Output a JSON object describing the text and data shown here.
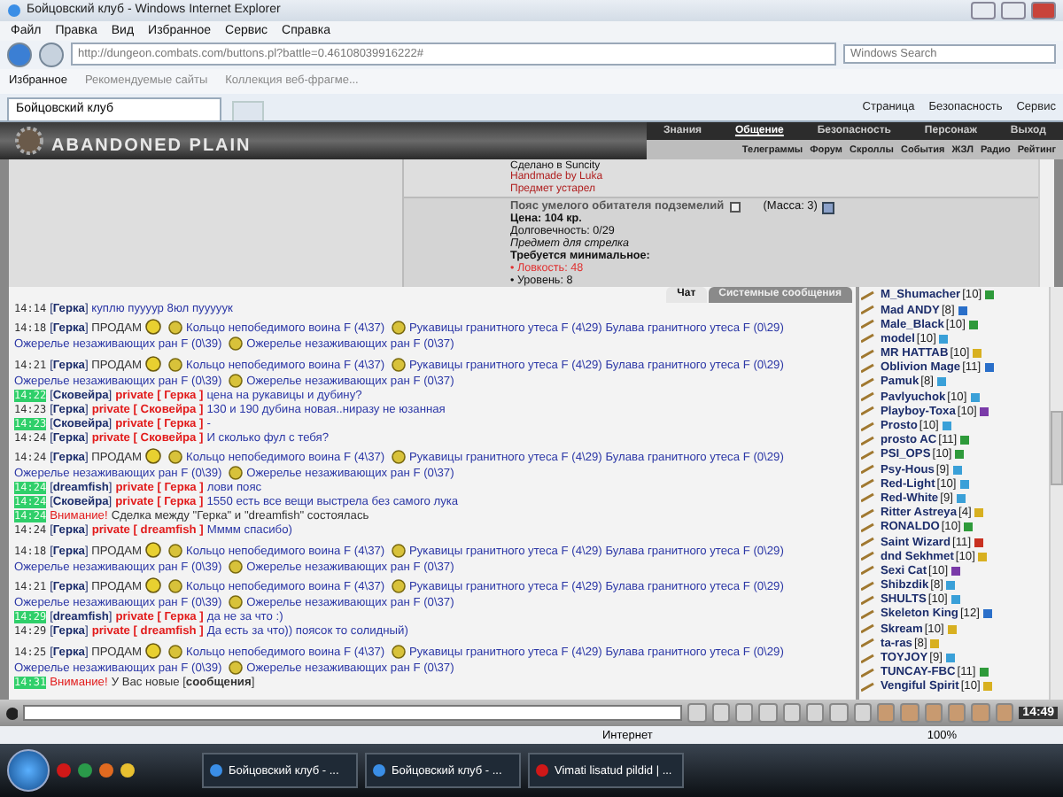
{
  "window": {
    "title": "Бойцовский клуб - Windows Internet Explorer"
  },
  "menu": [
    "Файл",
    "Правка",
    "Вид",
    "Избранное",
    "Сервис",
    "Справка"
  ],
  "address": {
    "value": "http://dungeon.combats.com/buttons.pl?battle=0.46108039916222#"
  },
  "search": {
    "placeholder": "Windows Search"
  },
  "favorites_bar": [
    {
      "label": "Избранное"
    },
    {
      "label": "Рекомендуемые сайты"
    },
    {
      "label": "Коллекция веб-фрагме..."
    }
  ],
  "tab": {
    "label": "Бойцовский клуб"
  },
  "commands": [
    "Страница",
    "Безопасность",
    "Сервис"
  ],
  "game": {
    "logo": "ABANDONED PLAIN",
    "nav": [
      {
        "label": "Знания",
        "selected": false
      },
      {
        "label": "Общение",
        "selected": true
      },
      {
        "label": "Безопасность",
        "selected": false
      },
      {
        "label": "Персонаж",
        "selected": false
      },
      {
        "label": "Выход",
        "selected": false
      }
    ],
    "subnav": [
      "Телеграммы",
      "Форум",
      "Скроллы",
      "События",
      "ЖЗЛ",
      "Радио",
      "Рейтинг"
    ]
  },
  "item_info": {
    "made_in": "Сделано в Suncity",
    "handmade": "Handmade by Luka",
    "outdated": "Предмет устарел",
    "name": "Пояс умелого обитателя подземелий",
    "mass": "(Масса: 3)",
    "price": "**Цена: 104 кр.**",
    "durability": "Долговечность: 0/29",
    "note": "Предмет для стрелка",
    "requires": "Требуется минимальное:",
    "requirements": [
      {
        "text": "• Ловкость: 48",
        "met": false
      },
      {
        "text": "• Уровень: 8",
        "met": true
      }
    ]
  },
  "chat_tabs": [
    {
      "label": "Чат",
      "selected": true
    },
    {
      "label": "Системные сообщения",
      "selected": false
    }
  ],
  "messages": [
    {
      "kind": "say",
      "time": "14:14",
      "highlight": false,
      "sender": "[**Герка**]",
      "text": "куплю пуууур 8юл пууууук"
    },
    {
      "kind": "sale",
      "time": "14:18",
      "highlight": false,
      "sender": "[**Герка**]",
      "verb": "ПРОДАМ",
      "items": [
        {
          "name": "Кольцо непобедимого воина F (4\\37)",
          "icon": true
        },
        {
          "name": "Рукавицы гранитного утеса F (4\\29)",
          "icon": true
        },
        {
          "name": "Булава гранитного утеса F (0\\29)",
          "icon": false
        },
        {
          "name": "Ожерелье незаживающих ран F (0\\39)",
          "icon": false
        },
        {
          "name": "Ожерелье незаживающих ран F (0\\37)",
          "icon": true
        }
      ]
    },
    {
      "kind": "sale",
      "time": "14:21",
      "highlight": false,
      "sender": "[**Герка**]",
      "verb": "ПРОДАМ",
      "items": [
        {
          "name": "Кольцо непобедимого воина F (4\\37)",
          "icon": true
        },
        {
          "name": "Рукавицы гранитного утеса F (4\\29)",
          "icon": true
        },
        {
          "name": "Булава гранитного утеса F (0\\29)",
          "icon": false
        },
        {
          "name": "Ожерелье незаживающих ран F (0\\39)",
          "icon": false
        },
        {
          "name": "Ожерелье незаживающих ран F (0\\37)",
          "icon": true
        }
      ]
    },
    {
      "kind": "private",
      "time": "14:22",
      "highlight": true,
      "sender": "[**Сковейра**]",
      "target": "private [ Герка ]",
      "text": "цена на рукавицы и дубину?"
    },
    {
      "kind": "private",
      "time": "14:23",
      "highlight": false,
      "sender": "[**Герка**]",
      "target": "private [ Сковейра ]",
      "text": "130 и 190 дубина новая..ниразу не юзанная"
    },
    {
      "kind": "private",
      "time": "14:23",
      "highlight": true,
      "sender": "[**Сковейра**]",
      "target": "private [ Герка ]",
      "text": "-"
    },
    {
      "kind": "private",
      "time": "14:24",
      "highlight": false,
      "sender": "[**Герка**]",
      "target": "private [ Сковейра ]",
      "text": "И сколько фул с тебя?"
    },
    {
      "kind": "sale",
      "time": "14:24",
      "highlight": false,
      "sender": "[**Герка**]",
      "verb": "ПРОДАМ",
      "items": [
        {
          "name": "Кольцо непобедимого воина F (4\\37)",
          "icon": true
        },
        {
          "name": "Рукавицы гранитного утеса F (4\\29)",
          "icon": true
        },
        {
          "name": "Булава гранитного утеса F (0\\29)",
          "icon": false
        },
        {
          "name": "Ожерелье незаживающих ран F (0\\39)",
          "icon": false
        },
        {
          "name": "Ожерелье незаживающих ран F (0\\37)",
          "icon": true
        }
      ]
    },
    {
      "kind": "private",
      "time": "14:24",
      "highlight": true,
      "sender": "[**dreamfish**]",
      "target": "private [ Герка ]",
      "text": "лови пояс"
    },
    {
      "kind": "private",
      "time": "14:24",
      "highlight": true,
      "sender": "[**Сковейра**]",
      "target": "private [ Герка ]",
      "text": "1550 есть все вещи выстрела без самого лука"
    },
    {
      "kind": "system",
      "time": "14:24",
      "highlight": true,
      "label": "Внимание!",
      "text": "Сделка между \"Герка\" и \"dreamfish\" состоялась"
    },
    {
      "kind": "private",
      "time": "14:24",
      "highlight": false,
      "sender": "[**Герка**]",
      "target": "private [ dreamfish ]",
      "text": "Мммм спасибо)"
    },
    {
      "kind": "sale",
      "time": "14:18",
      "highlight": false,
      "sender": "[**Герка**]",
      "verb": "ПРОДАМ",
      "items": [
        {
          "name": "Кольцо непобедимого воина F (4\\37)",
          "icon": true
        },
        {
          "name": "Рукавицы гранитного утеса F (4\\29)",
          "icon": true
        },
        {
          "name": "Булава гранитного утеса F (0\\29)",
          "icon": false
        },
        {
          "name": "Ожерелье незаживающих ран F (0\\39)",
          "icon": false
        },
        {
          "name": "Ожерелье незаживающих ран F (0\\37)",
          "icon": true
        }
      ]
    },
    {
      "kind": "sale",
      "time": "14:21",
      "highlight": false,
      "sender": "[**Герка**]",
      "verb": "ПРОДАМ",
      "items": [
        {
          "name": "Кольцо непобедимого воина F (4\\37)",
          "icon": true
        },
        {
          "name": "Рукавицы гранитного утеса F (4\\29)",
          "icon": true
        },
        {
          "name": "Булава гранитного утеса F (0\\29)",
          "icon": false
        },
        {
          "name": "Ожерелье незаживающих ран F (0\\39)",
          "icon": false
        },
        {
          "name": "Ожерелье незаживающих ран F (0\\37)",
          "icon": true
        }
      ]
    },
    {
      "kind": "private",
      "time": "14:29",
      "highlight": true,
      "sender": "[**dreamfish**]",
      "target": "private [ Герка ]",
      "text": "да не за что :)"
    },
    {
      "kind": "private",
      "time": "14:29",
      "highlight": false,
      "sender": "[**Герка**]",
      "target": "private [ dreamfish ]",
      "text": "Да есть за что)) поясок то солидный)"
    },
    {
      "kind": "sale",
      "time": "14:25",
      "highlight": false,
      "sender": "[**Герка**]",
      "verb": "ПРОДАМ",
      "items": [
        {
          "name": "Кольцо непобедимого воина F (4\\37)",
          "icon": true
        },
        {
          "name": "Рукавицы гранитного утеса F (4\\29)",
          "icon": true
        },
        {
          "name": "Булава гранитного утеса F (0\\29)",
          "icon": false
        },
        {
          "name": "Ожерелье незаживающих ран F (0\\39)",
          "icon": false
        },
        {
          "name": "Ожерелье незаживающих ран F (0\\37)",
          "icon": true
        }
      ]
    },
    {
      "kind": "system",
      "time": "14:31",
      "highlight": true,
      "label": "Внимание!",
      "text": "У Вас новые [**сообщения**]"
    }
  ],
  "users": [
    {
      "name": "M_Shumacher",
      "level": "[10]",
      "color": "#2e9a3a"
    },
    {
      "name": "Mad ANDY",
      "level": "[8]",
      "color": "#2a6fc9"
    },
    {
      "name": "Male_Black",
      "level": "[10]",
      "color": "#2e9a3a"
    },
    {
      "name": "model",
      "level": "[10]",
      "color": "#3aa0d8"
    },
    {
      "name": "MR HATTAB",
      "level": "[10]",
      "color": "#d8b020"
    },
    {
      "name": "Oblivion Mage",
      "level": "[11]",
      "color": "#2a6fc9"
    },
    {
      "name": "Pamuk",
      "level": "[8]",
      "color": "#3aa0d8"
    },
    {
      "name": "Pavlyuchok",
      "level": "[10]",
      "color": "#3aa0d8"
    },
    {
      "name": "Playboy-Toxa",
      "level": "[10]",
      "color": "#7a3aa8"
    },
    {
      "name": "Prosto",
      "level": "[10]",
      "color": "#3aa0d8"
    },
    {
      "name": "prosto AC",
      "level": "[11]",
      "color": "#2e9a3a"
    },
    {
      "name": "PSI_OPS",
      "level": "[10]",
      "color": "#2e9a3a"
    },
    {
      "name": "Psy-Hous",
      "level": "[9]",
      "color": "#3aa0d8"
    },
    {
      "name": "Red-Light",
      "level": "[10]",
      "color": "#3aa0d8"
    },
    {
      "name": "Red-White",
      "level": "[9]",
      "color": "#3aa0d8"
    },
    {
      "name": "Ritter Astreya",
      "level": "[4]",
      "color": "#d8b020"
    },
    {
      "name": "RONALDO",
      "level": "[10]",
      "color": "#2e9a3a"
    },
    {
      "name": "Saint Wizard",
      "level": "[11]",
      "color": "#c83020"
    },
    {
      "name": "dnd Sekhmet",
      "level": "[10]",
      "color": "#d8b020"
    },
    {
      "name": "Sexi Cat",
      "level": "[10]",
      "color": "#7a3aa8"
    },
    {
      "name": "Shibzdik",
      "level": "[8]",
      "color": "#3aa0d8"
    },
    {
      "name": "SHULTS",
      "level": "[10]",
      "color": "#3aa0d8"
    },
    {
      "name": "Skeleton King",
      "level": "[12]",
      "color": "#2a6fc9"
    },
    {
      "name": "Skream",
      "level": "[10]",
      "color": "#d8b020"
    },
    {
      "name": "ta-ras",
      "level": "[8]",
      "color": "#d8b020"
    },
    {
      "name": "TOYJOY",
      "level": "[9]",
      "color": "#3aa0d8"
    },
    {
      "name": "TUNCAY-FBC",
      "level": "[11]",
      "color": "#2e9a3a"
    },
    {
      "name": "Vengiful Spirit",
      "level": "[10]",
      "color": "#d8b020"
    }
  ],
  "clock": "14:49",
  "status_bar": {
    "zone": "Интернет",
    "zoom": "100%"
  },
  "taskbar": [
    {
      "label": "Бойцовский клуб - ...",
      "kind": "ie"
    },
    {
      "label": "Бойцовский клуб - ...",
      "kind": "ie"
    },
    {
      "label": "Vimati lisatud pildid | ...",
      "kind": "opera"
    }
  ]
}
